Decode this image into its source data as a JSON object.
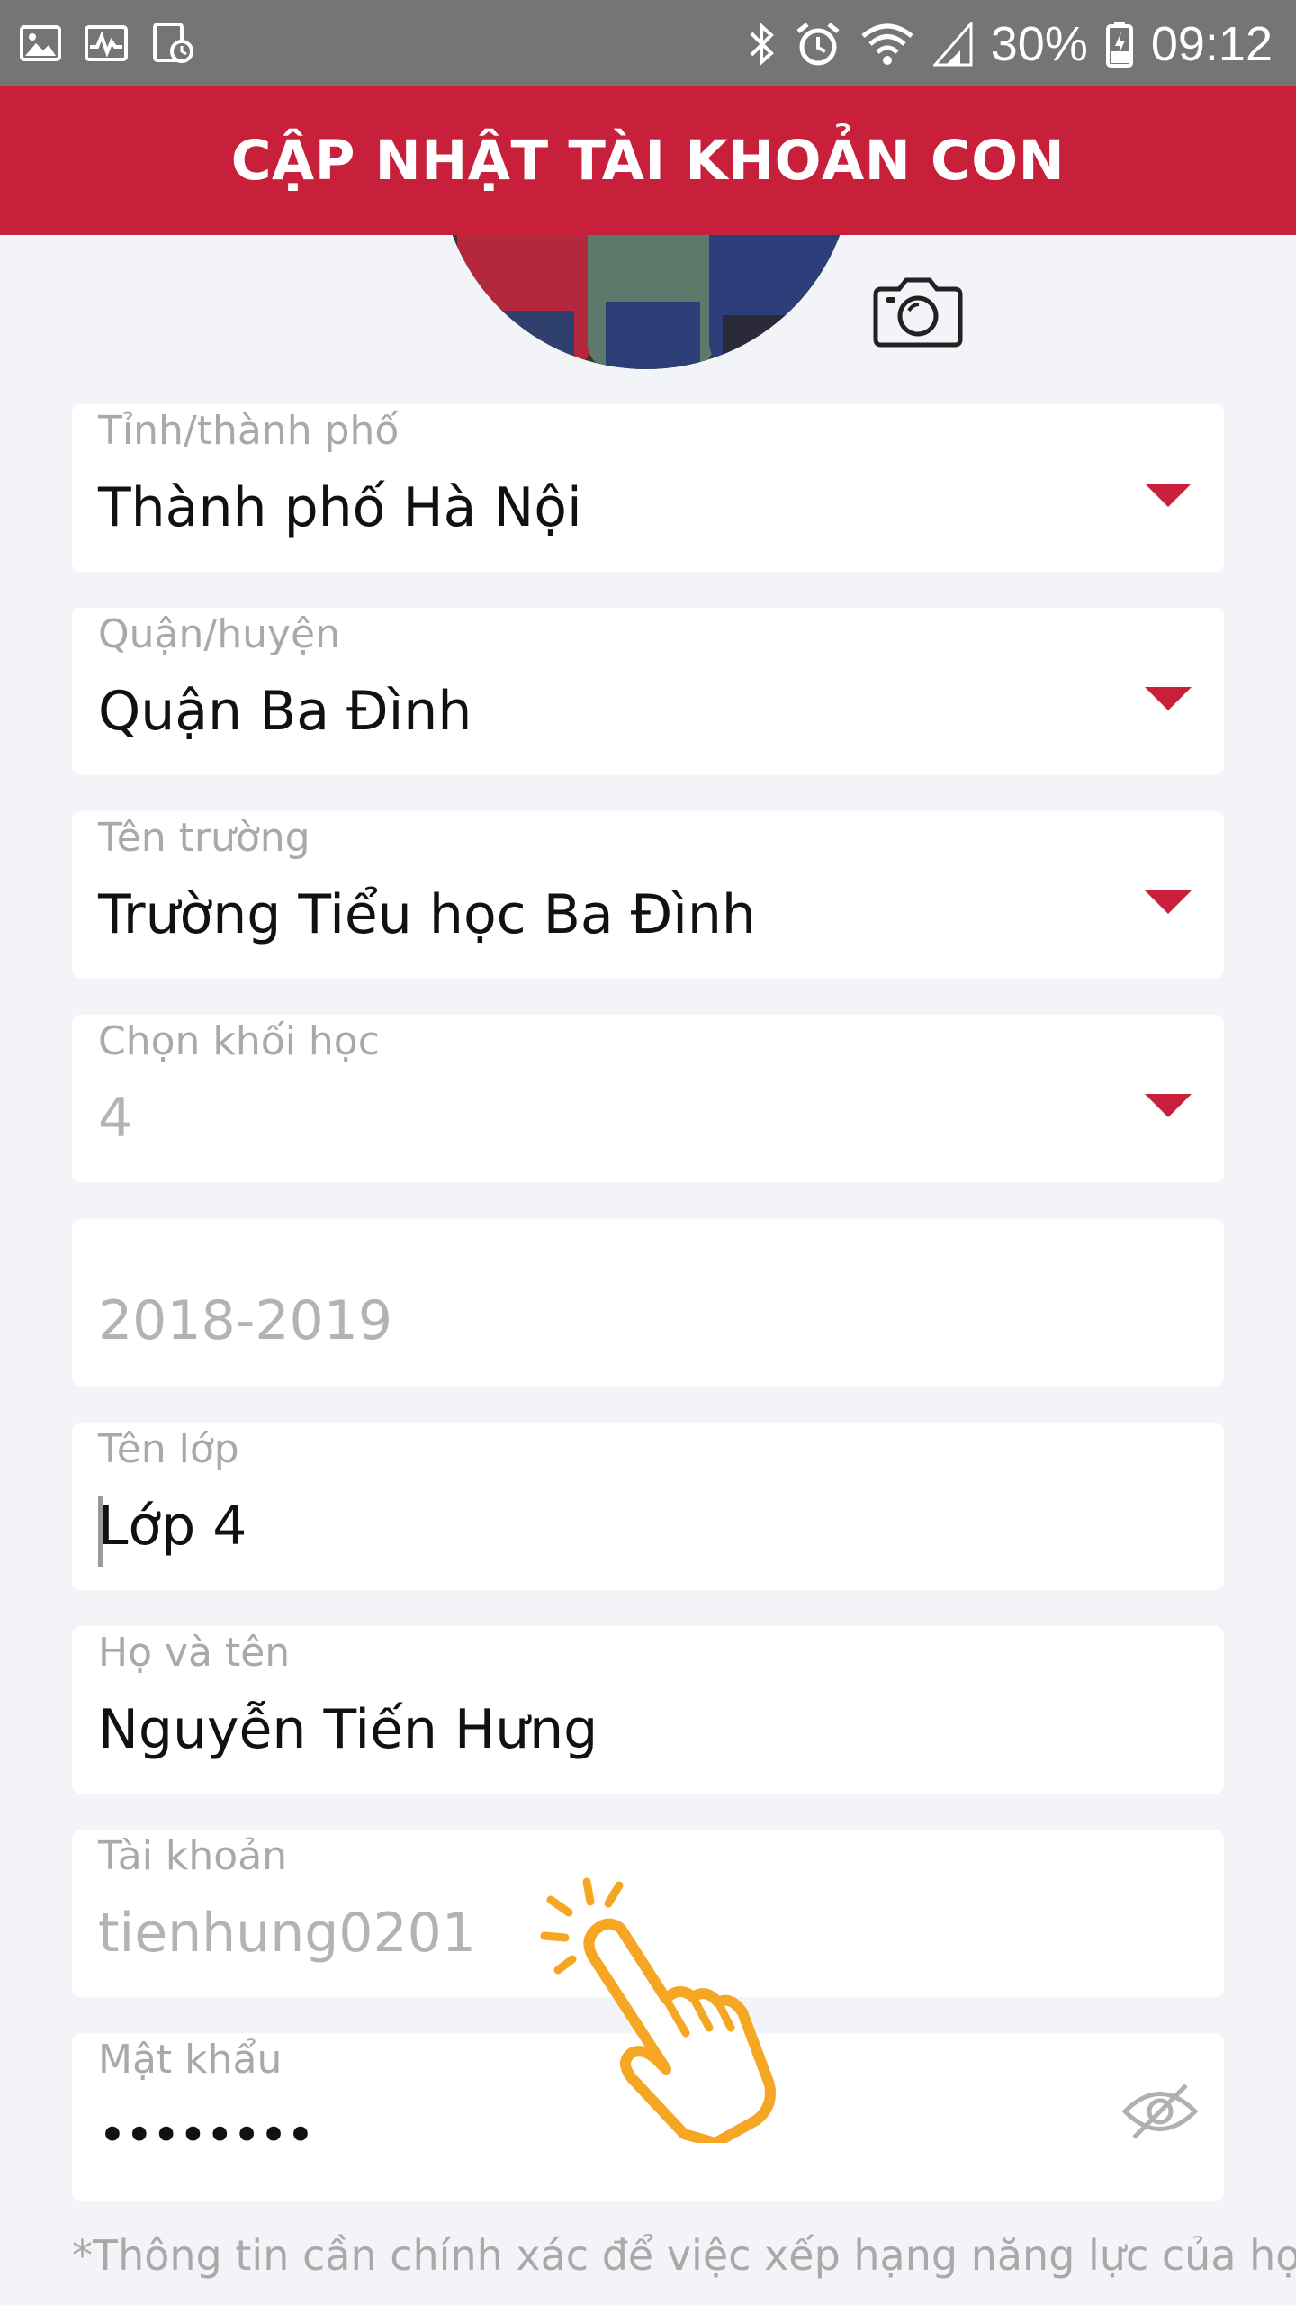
{
  "status_bar": {
    "battery": "30%",
    "time": "09:12",
    "icons_left": [
      "gallery-icon",
      "activity-icon",
      "storage-icon"
    ],
    "icons_right": [
      "bluetooth-icon",
      "alarm-icon",
      "wifi-icon",
      "signal-icon",
      "battery-icon"
    ]
  },
  "header": {
    "title": "CẬP NHẬT TÀI KHOẢN CON",
    "background": "#c8203a"
  },
  "form": {
    "province": {
      "label": "Tỉnh/thành phố",
      "value": "Thành phố Hà Nội"
    },
    "district": {
      "label": "Quận/huyện",
      "value": "Quận Ba Đình"
    },
    "school": {
      "label": "Tên trường",
      "value": "Trường Tiểu học Ba Đình"
    },
    "grade": {
      "label": "Chọn khối học",
      "value": "4"
    },
    "school_year": {
      "value": "2018-2019"
    },
    "class_name": {
      "label": "Tên lớp",
      "value": "Lớp 4"
    },
    "full_name": {
      "label": "Họ và tên",
      "value": "Nguyễn Tiến Hưng"
    },
    "account": {
      "label": "Tài khoản",
      "value": "tienhung0201"
    },
    "password": {
      "label": "Mật khẩu",
      "value": "••••••••"
    }
  },
  "note": "*Thông tin cần chính xác để việc xếp hạng năng lực của học",
  "colors": {
    "accent": "#c8203a",
    "hint": "#f5a623",
    "background": "#f2f4f7"
  }
}
